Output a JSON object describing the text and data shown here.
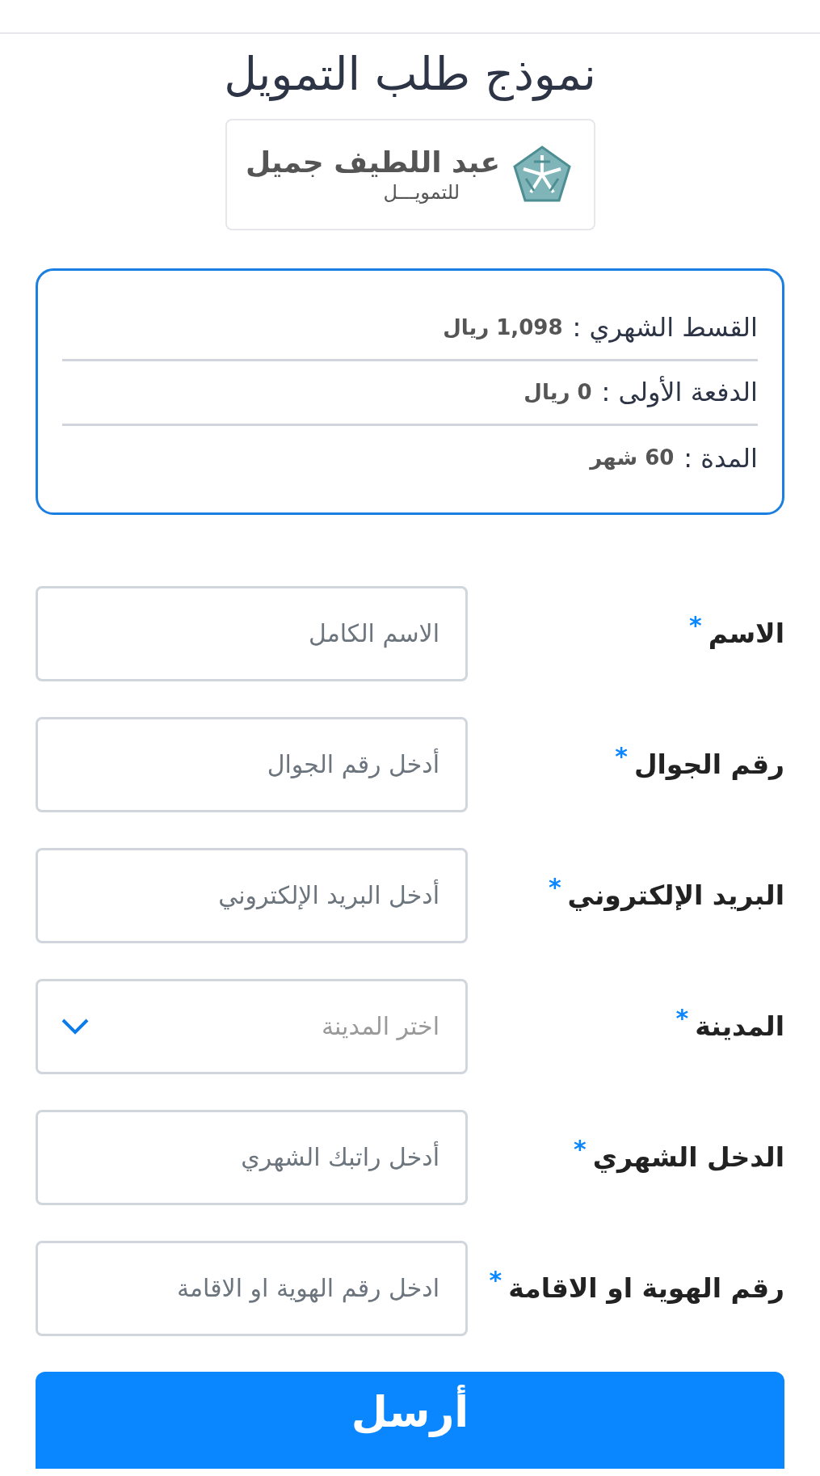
{
  "title": "نموذج طلب التمويل",
  "logo": {
    "name": "عبد اللطيف جميل",
    "tagline": "للتمويـــل"
  },
  "summary": [
    {
      "label": "القسط الشهري :",
      "value": "1,098 ريال"
    },
    {
      "label": "الدفعة الأولى :",
      "value": "0 ريال"
    },
    {
      "label": "المدة :",
      "value": "60 شهر"
    }
  ],
  "fields": [
    {
      "kind": "input",
      "label": "الاسم",
      "required_mark": "*",
      "placeholder": "الاسم الكامل"
    },
    {
      "kind": "input",
      "label": "رقم الجوال",
      "required_mark": "*",
      "placeholder": "أدخل رقم الجوال"
    },
    {
      "kind": "input",
      "label": "البريد الإلكتروني",
      "required_mark": "*",
      "placeholder": "أدخل البريد الإلكتروني"
    },
    {
      "kind": "select",
      "label": "المدينة",
      "required_mark": "*",
      "placeholder": "اختر المدينة"
    },
    {
      "kind": "input",
      "label": "الدخل الشهري",
      "required_mark": "*",
      "placeholder": "أدخل راتبك الشهري"
    },
    {
      "kind": "input",
      "label": "رقم الهوية او الاقامة",
      "required_mark": "*",
      "placeholder": "ادخل رقم الهوية او الاقامة"
    }
  ],
  "submit": "أرسل"
}
